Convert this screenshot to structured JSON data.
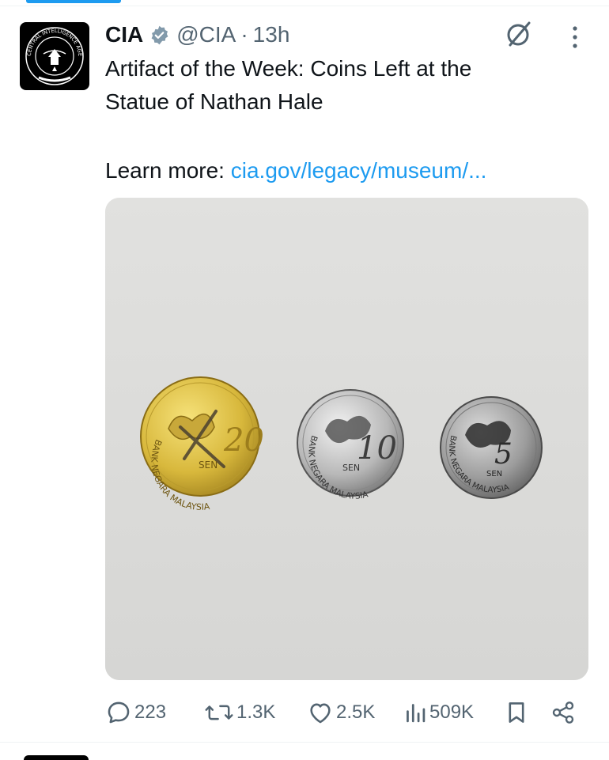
{
  "tweet": {
    "display_name": "CIA",
    "handle": "@CIA",
    "separator": "·",
    "timestamp": "13h",
    "text_line1": "Artifact of the Week: Coins Left at the",
    "text_line2": "Statue of Nathan Hale",
    "learn_more_prefix": "Learn more:",
    "link_text": "cia.gov/legacy/museum/...",
    "avatar_seal_text": "CENTRAL INTELLIGENCE AGENCY",
    "media": {
      "coins": [
        {
          "value": "20",
          "unit": "SEN",
          "inscription": "BANK NEGARA MALAYSIA",
          "metal": "gold"
        },
        {
          "value": "10",
          "unit": "SEN",
          "inscription": "BANK NEGARA MALAYSIA",
          "metal": "silver"
        },
        {
          "value": "5",
          "unit": "SEN",
          "inscription": "BANK NEGARA MALAYSIA",
          "metal": "silver"
        }
      ]
    }
  },
  "actions": {
    "replies": "223",
    "reposts": "1.3K",
    "likes": "2.5K",
    "views": "509K"
  },
  "icons": {
    "verified": "verified-badge-icon",
    "grok": "grok-icon",
    "more": "more-vertical-icon",
    "reply": "reply-icon",
    "repost": "repost-icon",
    "like": "heart-icon",
    "views": "views-icon",
    "bookmark": "bookmark-icon",
    "share": "share-icon"
  },
  "colors": {
    "link": "#1d9bf0",
    "secondary_text": "#536471",
    "tab_indicator": "#1d9bf0"
  }
}
